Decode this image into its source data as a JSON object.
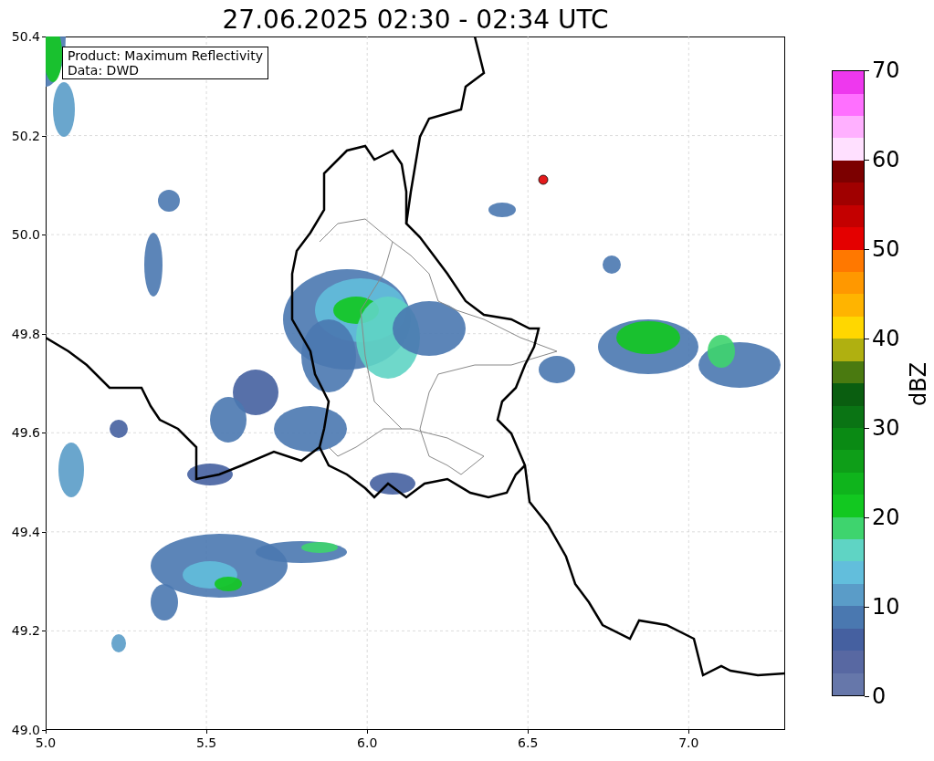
{
  "title": "27.06.2025 02:30 - 02:34 UTC",
  "info_box": [
    "Product: Maximum Reflectivity",
    "Data: DWD"
  ],
  "axes": {
    "xticks": [
      "5.0",
      "5.5",
      "6.0",
      "6.5",
      "7.0"
    ],
    "yticks": [
      "50.4",
      "50.2",
      "50.0",
      "49.8",
      "49.6",
      "49.4",
      "49.2",
      "49.0"
    ]
  },
  "colorbar": {
    "label": "dBZ",
    "ticks": [
      "70",
      "60",
      "50",
      "40",
      "30",
      "20",
      "10",
      "0"
    ],
    "bands": [
      {
        "color": "#6677aa"
      },
      {
        "color": "#5868a2"
      },
      {
        "color": "#4560a0"
      },
      {
        "color": "#4a78b0"
      },
      {
        "color": "#5a9cc8"
      },
      {
        "color": "#62bedc"
      },
      {
        "color": "#5fd4c4"
      },
      {
        "color": "#3ed46e"
      },
      {
        "color": "#12c820"
      },
      {
        "color": "#0fb41c"
      },
      {
        "color": "#0e9e18"
      },
      {
        "color": "#0a8a14"
      },
      {
        "color": "#0a7414"
      },
      {
        "color": "#0a5e10"
      },
      {
        "color": "#4a7a10"
      },
      {
        "color": "#b0b010"
      },
      {
        "color": "#ffd700"
      },
      {
        "color": "#ffb400"
      },
      {
        "color": "#ff9800"
      },
      {
        "color": "#ff7800"
      },
      {
        "color": "#e40000"
      },
      {
        "color": "#c40000"
      },
      {
        "color": "#a00000"
      },
      {
        "color": "#7c0000"
      },
      {
        "color": "#ffe0ff"
      },
      {
        "color": "#ffb0ff"
      },
      {
        "color": "#ff70ff"
      },
      {
        "color": "#ee38ee"
      }
    ]
  }
}
